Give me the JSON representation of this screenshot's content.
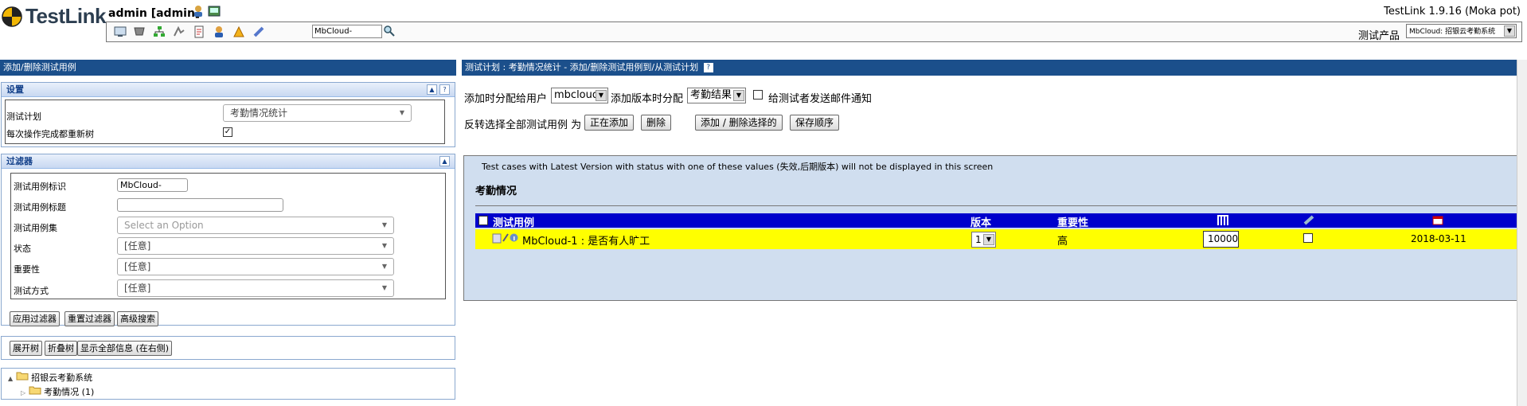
{
  "header": {
    "logo_text": "TestLink",
    "user": "admin [admin]",
    "version": "TestLink 1.9.16 (Moka pot)",
    "search_value": "MbCloud-",
    "product_label": "测试产品",
    "product_value": "MbCloud: 招银云考勤系统"
  },
  "left": {
    "title": "添加/删除测试用例",
    "settings": {
      "title": "设置",
      "test_plan_label": "测试计划",
      "test_plan_value": "考勤情况统计",
      "update_tree_label": "每次操作完成都重新树",
      "update_tree_checked": true
    },
    "filters": {
      "title": "过滤器",
      "tc_id_label": "测试用例标识",
      "tc_id_value": "MbCloud-",
      "tc_title_label": "测试用例标题",
      "tc_title_value": "",
      "tc_set_label": "测试用例集",
      "tc_set_placeholder": "Select an Option",
      "status_label": "状态",
      "status_value": "[任意]",
      "importance_label": "重要性",
      "importance_value": "[任意]",
      "exec_type_label": "测试方式",
      "exec_type_value": "[任意]",
      "apply_button": "应用过滤器",
      "reset_button": "重置过滤器",
      "advanced_button": "高级搜索"
    },
    "tree_buttons": {
      "expand": "展开树",
      "collapse": "折叠树",
      "show_all": "显示全部信息 (在右侧)"
    },
    "tree": {
      "root": "招银云考勤系统",
      "child": "考勤情况 (1)"
    }
  },
  "right": {
    "title": "测试计划 : 考勤情况统计 - 添加/删除测试用例到/从测试计划",
    "assign_label": "添加时分配给用户",
    "assign_value": "mbcloud",
    "platform_label": "添加版本时分配",
    "platform_value": "考勤结果",
    "email_label": "给测试者发送邮件通知",
    "invert_label": "反转选择全部测试用例 为",
    "btn_adding": "正在添加",
    "btn_remove": "删除",
    "btn_add_remove_selected": "添加 / 删除选择的",
    "btn_save_order": "保存顺序",
    "notice": "Test cases with Latest Version with status with one of these values (失效,后期版本) will not be displayed in this screen",
    "section_title": "考勤情况",
    "table": {
      "col_testcase": "测试用例",
      "col_version": "版本",
      "col_importance": "重要性",
      "rows": [
        {
          "name": "MbCloud-1 : 是否有人旷工",
          "version": "1",
          "importance": "高",
          "order": "10000",
          "date": "2018-03-11"
        }
      ]
    }
  },
  "colors": {
    "nav_blue": "#1b4f8b",
    "table_header_blue": "#0000cc",
    "row_highlight": "#ffff00",
    "container_bg": "#d0deef"
  }
}
